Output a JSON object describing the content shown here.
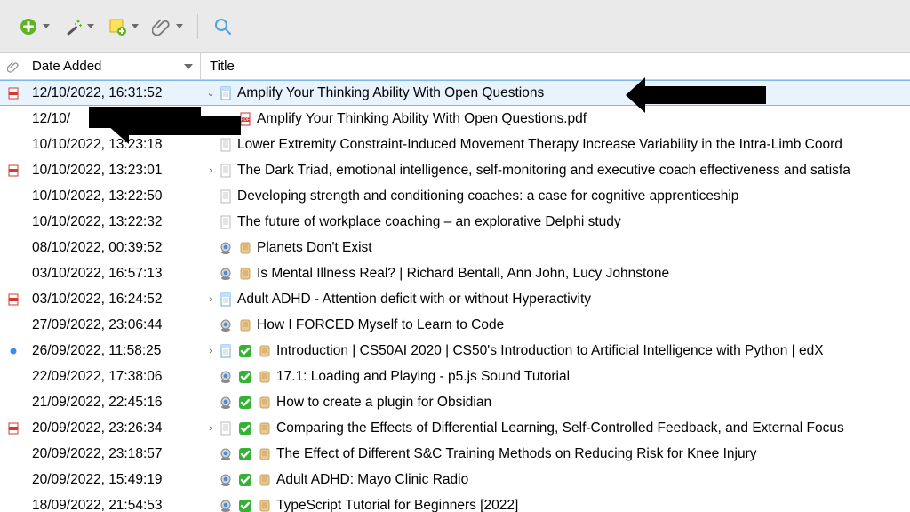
{
  "columns": {
    "date": "Date Added",
    "title": "Title"
  },
  "rows": [
    {
      "date": "12/10/2022, 16:31:52",
      "title": "Amplify Your Thinking Ability With Open Questions",
      "attach": "pdf",
      "twisty": "open",
      "indent": 0,
      "icons": [
        "doc-blue"
      ],
      "selected": true
    },
    {
      "date": "12/10/",
      "title": "Amplify Your Thinking Ability With Open Questions.pdf",
      "attach": "",
      "twisty": "",
      "indent": 1,
      "icons": [
        "pdf"
      ]
    },
    {
      "date": "10/10/2022, 13:23:18",
      "title": "Lower Extremity Constraint-Induced Movement Therapy Increase Variability in the Intra-Limb Coord",
      "attach": "",
      "twisty": "",
      "indent": 0,
      "icons": [
        "doc"
      ]
    },
    {
      "date": "10/10/2022, 13:23:01",
      "title": "The Dark Triad, emotional intelligence, self-monitoring and executive coach effectiveness and satisfa",
      "attach": "pdf",
      "twisty": "closed",
      "indent": 0,
      "icons": [
        "doc"
      ]
    },
    {
      "date": "10/10/2022, 13:22:50",
      "title": "Developing strength and conditioning coaches: a case for cognitive apprenticeship",
      "attach": "",
      "twisty": "",
      "indent": 0,
      "icons": [
        "doc"
      ]
    },
    {
      "date": "10/10/2022, 13:22:32",
      "title": "The future of workplace coaching – an explorative Delphi study",
      "attach": "",
      "twisty": "",
      "indent": 0,
      "icons": [
        "doc"
      ]
    },
    {
      "date": "08/10/2022, 00:39:52",
      "title": "Planets Don't Exist",
      "attach": "",
      "twisty": "",
      "indent": 0,
      "icons": [
        "webcam",
        "scroll"
      ]
    },
    {
      "date": "03/10/2022, 16:57:13",
      "title": "Is Mental Illness Real? | Richard Bentall, Ann John, Lucy Johnstone",
      "attach": "",
      "twisty": "",
      "indent": 0,
      "icons": [
        "webcam",
        "scroll"
      ]
    },
    {
      "date": "03/10/2022, 16:24:52",
      "title": "Adult ADHD - Attention deficit with or without Hyperactivity",
      "attach": "pdf",
      "twisty": "closed",
      "indent": 0,
      "icons": [
        "doc-blue"
      ]
    },
    {
      "date": "27/09/2022, 23:06:44",
      "title": "How I FORCED Myself to Learn to Code",
      "attach": "",
      "twisty": "",
      "indent": 0,
      "icons": [
        "webcam",
        "scroll"
      ]
    },
    {
      "date": "26/09/2022, 11:58:25",
      "title": "Introduction | CS50AI 2020 | CS50's Introduction to Artificial Intelligence with Python | edX",
      "attach": "blue-dot",
      "twisty": "closed",
      "indent": 0,
      "icons": [
        "doc-blue",
        "check",
        "scroll"
      ]
    },
    {
      "date": "22/09/2022, 17:38:06",
      "title": "17.1: Loading and Playing - p5.js Sound Tutorial",
      "attach": "",
      "twisty": "",
      "indent": 0,
      "icons": [
        "webcam",
        "check",
        "scroll"
      ]
    },
    {
      "date": "21/09/2022, 22:45:16",
      "title": "How to create a plugin for Obsidian",
      "attach": "",
      "twisty": "",
      "indent": 0,
      "icons": [
        "webcam",
        "check",
        "scroll"
      ]
    },
    {
      "date": "20/09/2022, 23:26:34",
      "title": "Comparing the Effects of Differential Learning, Self-Controlled Feedback, and External Focus",
      "attach": "pdf",
      "twisty": "closed",
      "indent": 0,
      "icons": [
        "doc",
        "check",
        "scroll"
      ]
    },
    {
      "date": "20/09/2022, 23:18:57",
      "title": "The Effect of Different S&C Training Methods on Reducing Risk for Knee Injury",
      "attach": "",
      "twisty": "",
      "indent": 0,
      "icons": [
        "webcam",
        "check",
        "scroll"
      ]
    },
    {
      "date": "20/09/2022, 15:49:19",
      "title": "Adult ADHD: Mayo Clinic Radio",
      "attach": "",
      "twisty": "",
      "indent": 0,
      "icons": [
        "webcam",
        "check",
        "scroll"
      ]
    },
    {
      "date": "18/09/2022, 21:54:53",
      "title": "TypeScript Tutorial for Beginners [2022]",
      "attach": "",
      "twisty": "",
      "indent": 0,
      "icons": [
        "webcam",
        "check",
        "scroll"
      ]
    }
  ]
}
